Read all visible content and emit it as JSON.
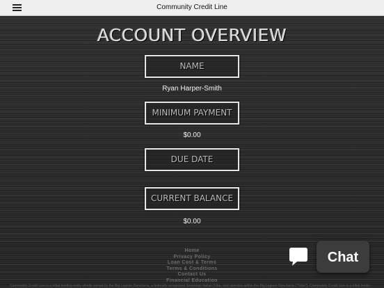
{
  "header": {
    "title": "Community Credit Line",
    "menu_icon": "hamburger-menu-icon"
  },
  "page": {
    "heading": "ACCOUNT OVERVIEW"
  },
  "fields": {
    "name": {
      "label": "NAME",
      "value": "Ryan Harper-Smith"
    },
    "minimum_payment": {
      "label": "MINIMUM PAYMENT",
      "value": "$0.00"
    },
    "due_date": {
      "label": "DUE DATE",
      "value": ""
    },
    "current_balance": {
      "label": "CURRENT BALANCE",
      "value": "$0.00"
    }
  },
  "footer": {
    "links": [
      "Home",
      "Privacy Policy",
      "Loan Cost & Terms",
      "Terms & Conditions",
      "Contact Us",
      "Financial Education"
    ],
    "disclaimer": "Community Credit Line is a tribal lending entity wholly owned by the Big Lagoon Rancheria, a federally recognized Sovereign Indian Tribe, and operates within the Big Lagoon Rancheria (\"Tribe\"). Community Credit Line is a tribal lending entity"
  },
  "chat": {
    "label": "Chat",
    "icon": "chat-bubble-icon",
    "colors": {
      "widget_bg": "#3c3c3c",
      "text": "#ffffff"
    }
  }
}
